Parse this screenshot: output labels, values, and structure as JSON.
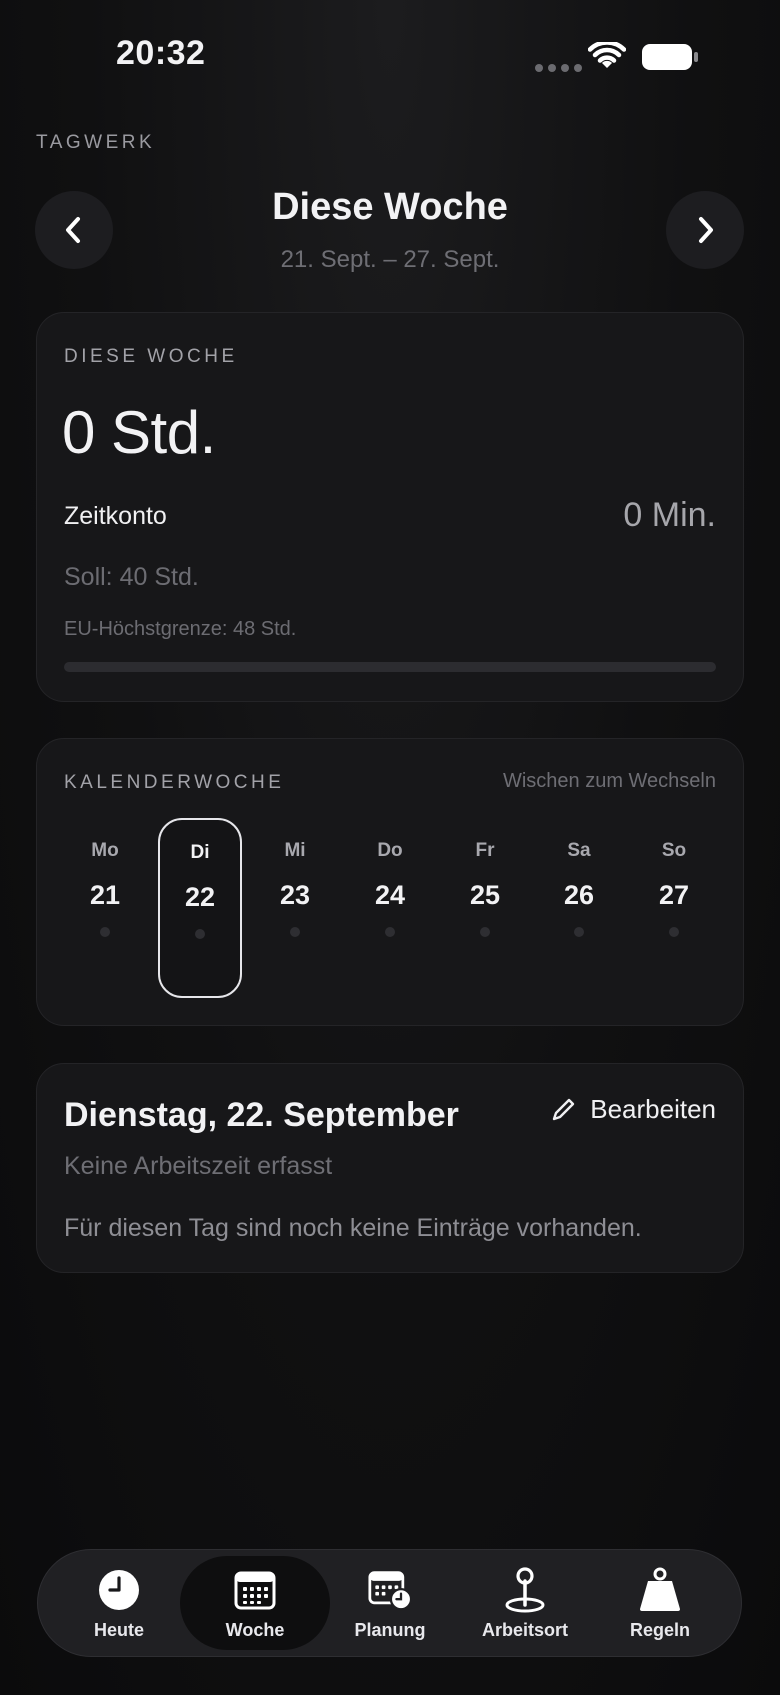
{
  "status_bar": {
    "time": "20:32"
  },
  "app": {
    "name": "TAGWERK"
  },
  "header": {
    "title": "Diese Woche",
    "range": "21. Sept. – 27. Sept."
  },
  "week_summary": {
    "label": "DIESE WOCHE",
    "hours": "0 Std.",
    "zeitkonto_label": "Zeitkonto",
    "zeitkonto_value": "0 Min.",
    "soll": "Soll: 40 Std.",
    "eu_limit": "EU-Höchstgrenze: 48 Std.",
    "progress_fraction": 0
  },
  "calendar": {
    "label": "KALENDERWOCHE",
    "hint": "Wischen zum Wechseln",
    "days": [
      {
        "name": "Mo",
        "num": "21",
        "selected": false
      },
      {
        "name": "Di",
        "num": "22",
        "selected": true
      },
      {
        "name": "Mi",
        "num": "23",
        "selected": false
      },
      {
        "name": "Do",
        "num": "24",
        "selected": false
      },
      {
        "name": "Fr",
        "num": "25",
        "selected": false
      },
      {
        "name": "Sa",
        "num": "26",
        "selected": false
      },
      {
        "name": "So",
        "num": "27",
        "selected": false
      }
    ]
  },
  "day_detail": {
    "title": "Dienstag, 22. September",
    "edit_label": "Bearbeiten",
    "status": "Keine Arbeitszeit erfasst",
    "empty_text": "Für diesen Tag sind noch keine Einträge vorhanden."
  },
  "tabs": [
    {
      "label": "Heute",
      "icon": "clock-icon",
      "active": false
    },
    {
      "label": "Woche",
      "icon": "calendar-icon",
      "active": true
    },
    {
      "label": "Planung",
      "icon": "calendar-clock-icon",
      "active": false
    },
    {
      "label": "Arbeitsort",
      "icon": "location-pin-icon",
      "active": false
    },
    {
      "label": "Regeln",
      "icon": "weight-icon",
      "active": false
    }
  ]
}
